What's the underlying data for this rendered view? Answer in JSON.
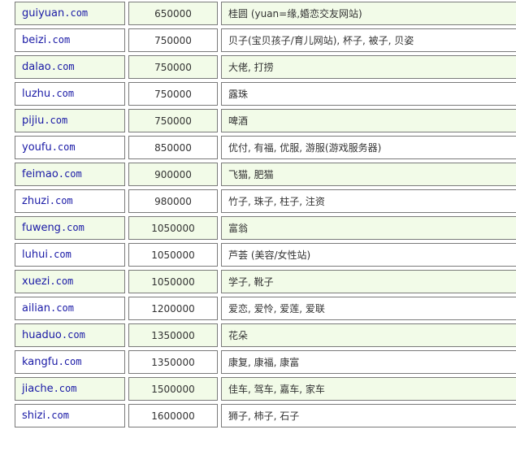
{
  "rows": [
    {
      "name": "guiyuan",
      "tld": ".com",
      "price": "650000",
      "meaning": "桂圆 (yuan=缘,婚恋交友网站)"
    },
    {
      "name": "beizi",
      "tld": ".com",
      "price": "750000",
      "meaning": "贝子(宝贝孩子/育儿网站), 杯子, 被子, 贝姿"
    },
    {
      "name": "dalao",
      "tld": ".com",
      "price": "750000",
      "meaning": "大佬, 打捞"
    },
    {
      "name": "luzhu",
      "tld": ".com",
      "price": "750000",
      "meaning": "露珠"
    },
    {
      "name": "pijiu",
      "tld": ".com",
      "price": "750000",
      "meaning": "啤酒"
    },
    {
      "name": "youfu",
      "tld": ".com",
      "price": "850000",
      "meaning": "优付, 有福, 优服, 游服(游戏服务器)"
    },
    {
      "name": "feimao",
      "tld": ".com",
      "price": "900000",
      "meaning": "飞猫, 肥猫"
    },
    {
      "name": "zhuzi",
      "tld": ".com",
      "price": "980000",
      "meaning": "竹子, 珠子, 柱子, 注资"
    },
    {
      "name": "fuweng",
      "tld": ".com",
      "price": "1050000",
      "meaning": "富翁"
    },
    {
      "name": "luhui",
      "tld": ".com",
      "price": "1050000",
      "meaning": "芦荟 (美容/女性站)"
    },
    {
      "name": "xuezi",
      "tld": ".com",
      "price": "1050000",
      "meaning": "学子, 靴子"
    },
    {
      "name": "ailian",
      "tld": ".com",
      "price": "1200000",
      "meaning": "爱恋, 爱怜, 爱莲, 爱联"
    },
    {
      "name": "huaduo",
      "tld": ".com",
      "price": "1350000",
      "meaning": "花朵"
    },
    {
      "name": "kangfu",
      "tld": ".com",
      "price": "1350000",
      "meaning": "康复, 康福, 康富"
    },
    {
      "name": "jiache",
      "tld": ".com",
      "price": "1500000",
      "meaning": "佳车, 驾车, 嘉车, 家车"
    },
    {
      "name": "shizi",
      "tld": ".com",
      "price": "1600000",
      "meaning": "狮子, 柿子, 石子"
    }
  ]
}
